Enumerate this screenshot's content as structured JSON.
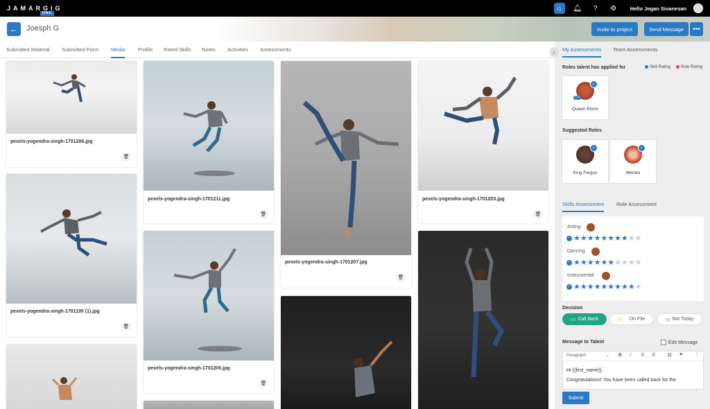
{
  "app": {
    "logo": "JAMARGIG",
    "logo_sub": "ONE",
    "greeting_prefix": "Hello",
    "user_name": "Jegan Sivanesan"
  },
  "header": {
    "name": "Joesph G",
    "invite_label": "Invite to project",
    "send_label": "Send Message"
  },
  "tabs": [
    "Submitted Material",
    "Submitted Form",
    "Media",
    "Profile",
    "Rated Skills",
    "Notes",
    "Activities",
    "Assessments"
  ],
  "active_tab": "Media",
  "media": [
    {
      "name": "pexels-yogendra-singh-1701206.jpg"
    },
    {
      "name": "pexels-yogendra-singh-1701195 (1).jpg"
    },
    {
      "name": "pexels-yogendra-singh-1701211.jpg"
    },
    {
      "name": "pexels-yogendra-singh-1701200.jpg"
    },
    {
      "name": "pexels-yogendra-singh-1701207.jpg"
    },
    {
      "name": "pexels-yogendra-singh-1701203.jpg"
    }
  ],
  "right": {
    "tabs": [
      "My Assessments",
      "Team Assessments"
    ],
    "applied_title": "Roles talent has applied for",
    "legend_skill": "Skill Rating",
    "legend_role": "Role Rating",
    "applied_roles": [
      {
        "name": "Queen Elinor",
        "rating": "7.7"
      }
    ],
    "suggested_title": "Suggested Roles",
    "suggested_roles": [
      {
        "name": "King Fergus"
      },
      {
        "name": "Merida"
      }
    ],
    "assess_tabs": [
      "Skills Assessment",
      "Role Assessment"
    ],
    "skills": [
      {
        "name": "Acting",
        "rating": 8,
        "max": 10
      },
      {
        "name": "Dancing",
        "rating": 6,
        "max": 10
      },
      {
        "name": "Instrumental",
        "rating": 9,
        "max": 10
      }
    ],
    "decision_title": "Decision",
    "decisions": [
      "Call Back",
      "On File",
      "Not Today"
    ],
    "message_title": "Message to Talent",
    "edit_message": "Edit Message",
    "editor_style": "Paragraph",
    "message_line1": "Hi {{first_name}},",
    "message_line2": "Congratulations! You have been called back for the",
    "submit": "Submit"
  },
  "colors": {
    "accent": "#2b78c5",
    "call_back": "#1ea680",
    "not_today": "#e0454f",
    "on_file": "#f0b400"
  }
}
